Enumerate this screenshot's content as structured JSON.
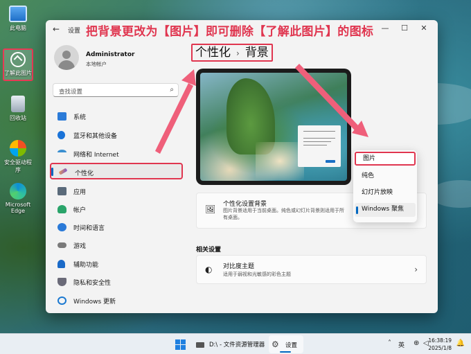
{
  "desktop": {
    "icons": [
      {
        "label": "此电脑"
      },
      {
        "label": "了解此图片"
      },
      {
        "label": "回收站"
      },
      {
        "label": "安全驱动程序"
      },
      {
        "label": "Microsoft Edge"
      }
    ]
  },
  "window": {
    "title": "设置",
    "annotation": "把背景更改为【图片】即可删除【了解此图片】的图标",
    "controls": {
      "minimize": "—",
      "maximize": "☐",
      "close": "✕"
    }
  },
  "profile": {
    "name": "Administrator",
    "account_type": "本地帐户"
  },
  "search": {
    "placeholder": "查找设置"
  },
  "sidebar": {
    "items": [
      {
        "label": "系统",
        "color": "#2b7bd8"
      },
      {
        "label": "蓝牙和其他设备",
        "color": "#1a73d8"
      },
      {
        "label": "网络和 Internet",
        "color": "#3a8fd0"
      },
      {
        "label": "个性化",
        "color": "#c87a3a",
        "active": true
      },
      {
        "label": "应用",
        "color": "#5a6a7a"
      },
      {
        "label": "帐户",
        "color": "#2aa46a"
      },
      {
        "label": "时间和语言",
        "color": "#2a7ad8"
      },
      {
        "label": "游戏",
        "color": "#7a7a7a"
      },
      {
        "label": "辅助功能",
        "color": "#1a6ac8"
      },
      {
        "label": "隐私和安全性",
        "color": "#6a6a78"
      },
      {
        "label": "Windows 更新",
        "color": "#1a78d0"
      }
    ]
  },
  "content": {
    "breadcrumb": {
      "parent": "个性化",
      "separator": "›",
      "current": "背景"
    },
    "background_card": {
      "title": "个性化设置背景",
      "description": "图片背景适用于当前桌面。纯色或幻灯片背景则适用于所有桌面。"
    },
    "dropdown": {
      "options": [
        "图片",
        "纯色",
        "幻灯片放映",
        "Windows 聚焦"
      ],
      "selected": "Windows 聚焦",
      "highlighted": "图片"
    },
    "related_settings_label": "相关设置",
    "contrast_card": {
      "title": "对比度主题",
      "description": "适用于弱视和光敏感的彩色主题"
    }
  },
  "taskbar": {
    "explorer_label": "D:\\ - 文件资源管理器",
    "settings_label": "设置",
    "language": "英",
    "time": "16:38:19",
    "date": "2025/1/8"
  },
  "colors": {
    "annotation_red": "#e0354f",
    "accent": "#0067c0"
  }
}
